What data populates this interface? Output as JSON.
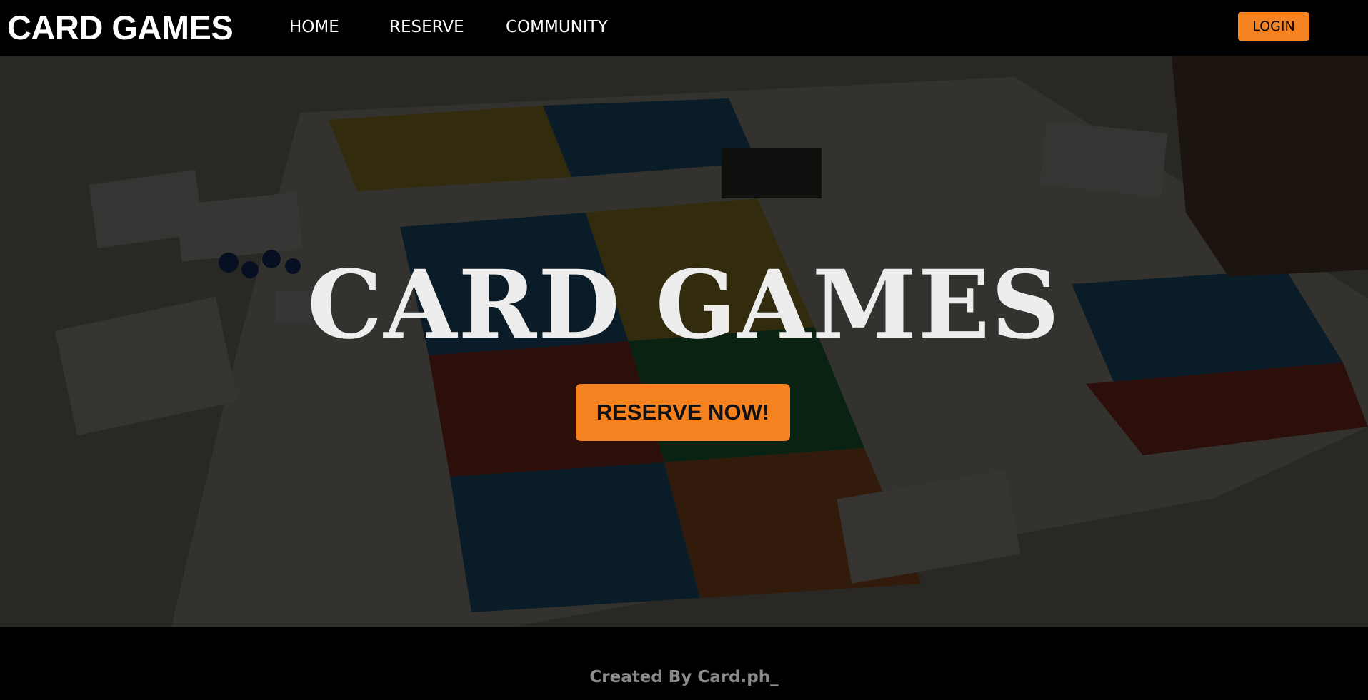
{
  "header": {
    "brand": "CARD GAMES",
    "nav": [
      {
        "label": "HOME"
      },
      {
        "label": "RESERVE"
      },
      {
        "label": "COMMUNITY"
      }
    ],
    "login_label": "LOGIN"
  },
  "hero": {
    "title": "CARD GAMES",
    "cta_label": "RESERVE NOW!"
  },
  "footer": {
    "credit": "Created By Card.ph_"
  },
  "colors": {
    "accent": "#f58220",
    "background": "#000000",
    "hero_text": "#ededed",
    "footer_text": "#8a8a8a"
  }
}
